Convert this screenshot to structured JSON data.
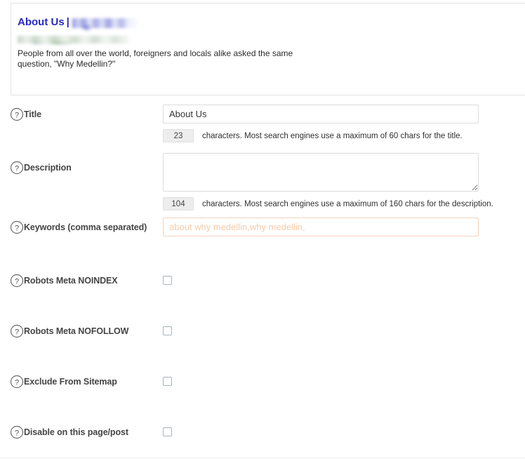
{
  "snippet_preview": {
    "title": "About Us",
    "title_separator": "|",
    "title_site_redacted": "",
    "url_redacted": "",
    "description": "People from all over the world, foreigners and locals alike asked the same question, \"Why Medellin?\""
  },
  "colors": {
    "snippet_title": "#2727c4",
    "snippet_url_blur": "#a8c0a8",
    "keyword_placeholder": "#f5cbaa",
    "checkbox_border": "#aab4bd",
    "counter_background": "#ededed"
  },
  "fields": {
    "title": {
      "label": "Title",
      "help_icon": "question-circle-icon",
      "value": "About Us",
      "placeholder": "",
      "counter": "23",
      "note": "characters. Most search engines use a maximum of 60 chars for the title."
    },
    "description": {
      "label": "Description",
      "help_icon": "question-circle-icon",
      "value": "",
      "placeholder": "",
      "counter": "104",
      "note": "characters. Most search engines use a maximum of 160 chars for the description."
    },
    "keywords": {
      "label": "Keywords (comma separated)",
      "help_icon": "question-circle-icon",
      "value": "",
      "placeholder": "about why medellin,why medellin,"
    }
  },
  "checkboxes": [
    {
      "label": "Robots Meta NOINDEX",
      "help_icon": "question-circle-icon",
      "checked": false
    },
    {
      "label": "Robots Meta NOFOLLOW",
      "help_icon": "question-circle-icon",
      "checked": false
    },
    {
      "label": "Exclude From Sitemap",
      "help_icon": "question-circle-icon",
      "checked": false
    },
    {
      "label": "Disable on this page/post",
      "help_icon": "question-circle-icon",
      "checked": false
    }
  ]
}
